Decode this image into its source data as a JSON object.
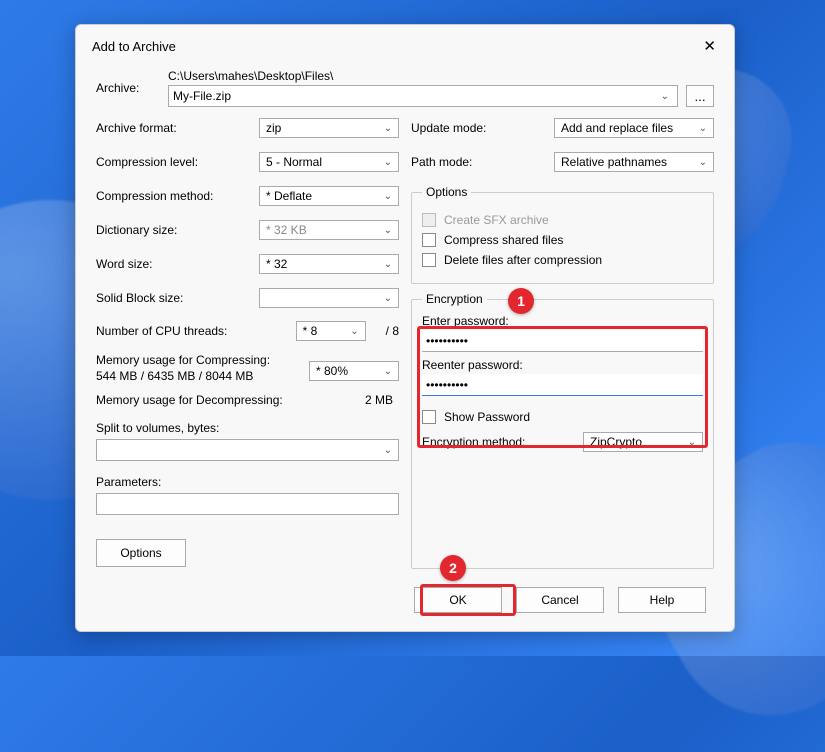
{
  "title": "Add to Archive",
  "archive": {
    "label": "Archive:",
    "path": "C:\\Users\\mahes\\Desktop\\Files\\",
    "filename": "My-File.zip",
    "browse": "..."
  },
  "left": {
    "format": {
      "label": "Archive format:",
      "value": "zip"
    },
    "level": {
      "label": "Compression level:",
      "value": "5 - Normal"
    },
    "method": {
      "label": "Compression method:",
      "value": "* Deflate"
    },
    "dict": {
      "label": "Dictionary size:",
      "value": "* 32 KB"
    },
    "word": {
      "label": "Word size:",
      "value": "* 32"
    },
    "block": {
      "label": "Solid Block size:",
      "value": ""
    },
    "cpu": {
      "label": "Number of CPU threads:",
      "value": "* 8",
      "total": "/ 8"
    },
    "memC": {
      "label1": "Memory usage for Compressing:",
      "label2": "544 MB / 6435 MB / 8044 MB",
      "value": "* 80%"
    },
    "memD": {
      "label": "Memory usage for Decompressing:",
      "value": "2 MB"
    },
    "split": {
      "label": "Split to volumes, bytes:",
      "value": ""
    },
    "params": {
      "label": "Parameters:",
      "value": ""
    },
    "options_btn": "Options"
  },
  "right": {
    "update": {
      "label": "Update mode:",
      "value": "Add and replace files"
    },
    "path": {
      "label": "Path mode:",
      "value": "Relative pathnames"
    },
    "options": {
      "legend": "Options",
      "sfx": "Create SFX archive",
      "shared": "Compress shared files",
      "delete": "Delete files after compression"
    },
    "encryption": {
      "legend": "Encryption",
      "enter": "Enter password:",
      "enter_val": "••••••••••",
      "reenter": "Reenter password:",
      "reenter_val": "••••••••••",
      "show": "Show Password",
      "method_label": "Encryption method:",
      "method_value": "ZipCrypto"
    }
  },
  "buttons": {
    "ok": "OK",
    "cancel": "Cancel",
    "help": "Help"
  },
  "callouts": {
    "one": "1",
    "two": "2"
  }
}
